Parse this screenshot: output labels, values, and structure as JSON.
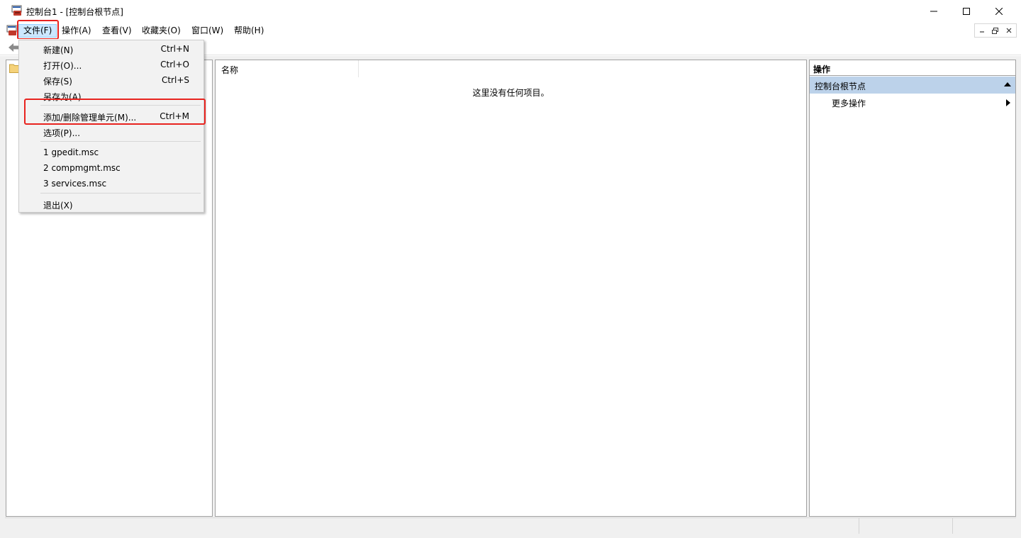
{
  "window": {
    "title": "控制台1 - [控制台根节点]"
  },
  "menubar": {
    "items": [
      "文件(F)",
      "操作(A)",
      "查看(V)",
      "收藏夹(O)",
      "窗口(W)",
      "帮助(H)"
    ]
  },
  "file_menu": {
    "items": [
      {
        "label": "新建(N)",
        "shortcut": "Ctrl+N"
      },
      {
        "label": "打开(O)...",
        "shortcut": "Ctrl+O"
      },
      {
        "label": "保存(S)",
        "shortcut": "Ctrl+S"
      },
      {
        "label": "另存为(A)...",
        "shortcut": ""
      },
      {
        "label": "添加/删除管理单元(M)...",
        "shortcut": "Ctrl+M"
      },
      {
        "label": "选项(P)...",
        "shortcut": ""
      },
      {
        "label": "1 gpedit.msc",
        "shortcut": ""
      },
      {
        "label": "2 compmgmt.msc",
        "shortcut": ""
      },
      {
        "label": "3 services.msc",
        "shortcut": ""
      },
      {
        "label": "退出(X)",
        "shortcut": ""
      }
    ]
  },
  "result_pane": {
    "column_name": "名称",
    "empty_message": "这里没有任何项目。"
  },
  "action_pane": {
    "title": "操作",
    "group": "控制台根节点",
    "more": "更多操作"
  },
  "colors": {
    "highlight_box": "#e8231f",
    "action_group_bg": "#bcd2ea",
    "menu_active_bg": "#cce8ff"
  }
}
